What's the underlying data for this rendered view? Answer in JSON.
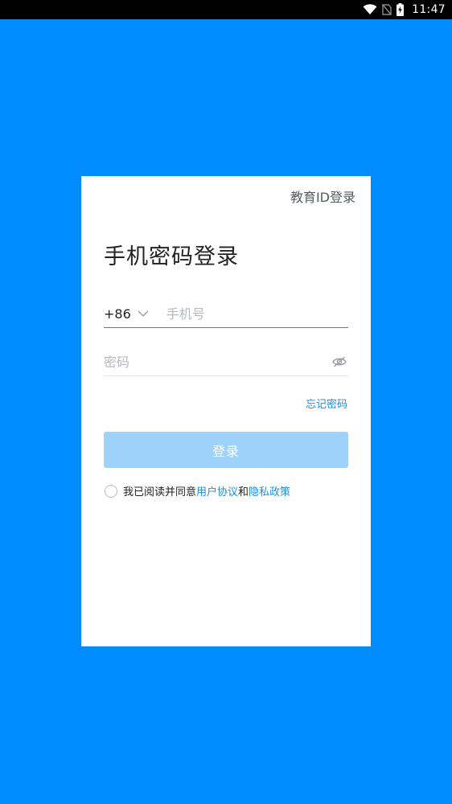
{
  "status_bar": {
    "time": "11:47",
    "icons": [
      "wifi-icon",
      "no-sim-icon",
      "battery-charging-icon"
    ]
  },
  "card": {
    "edu_login_link": "教育ID登录",
    "title": "手机密码登录",
    "phone": {
      "country_code": "+86",
      "placeholder": "手机号",
      "value": ""
    },
    "password": {
      "placeholder": "密码",
      "value": "",
      "toggle_icon": "eye-off-icon"
    },
    "forgot_password": "忘记密码",
    "login_button": "登录",
    "agreement": {
      "prefix": "我已阅读并同意",
      "user_agreement": "用户协议",
      "conjunction": "和",
      "privacy_policy": "隐私政策",
      "checked": false
    }
  },
  "colors": {
    "background": "#008cff",
    "accent": "#1a8fe6",
    "button_disabled": "#9dd2fb",
    "status_bar": "#000000"
  }
}
